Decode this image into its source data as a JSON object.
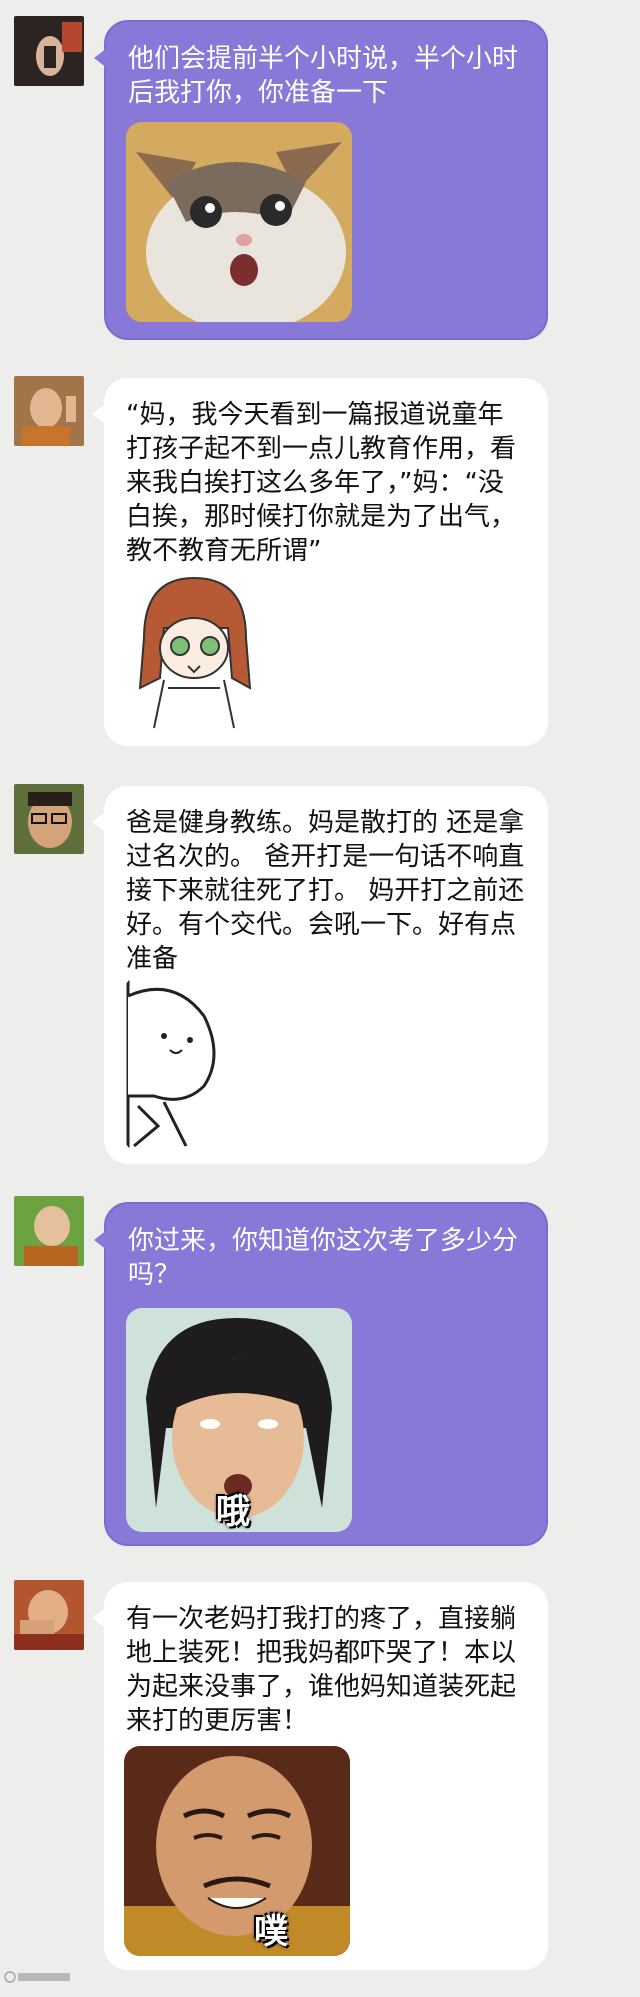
{
  "messages": [
    {
      "text": "他们会提前半个小时说，半个小时后我打你，你准备一下",
      "sticker": "shocked-cat-icon"
    },
    {
      "text": "“妈，我今天看到一篇报道说童年打孩子起不到一点儿教育作用，看来我白挨打这么多年了，”妈：“没白挨，那时候打你就是为了出气，教不教育无所谓”",
      "sticker": "cartoon-girl-icon"
    },
    {
      "text": "爸是健身教练。妈是散打的 还是拿过名次的。 爸开打是一句话不响直接下来就往死了打。 妈开打之前还好。有个交代。会吼一下。好有点准备",
      "sticker": "peeking-blob-icon"
    },
    {
      "text": "你过来，你知道你这次考了多少分吗？",
      "sticker": "surprised-man-icon",
      "caption": "哦"
    },
    {
      "text": "有一次老妈打我打的疼了，直接躺地上装死！把我妈都吓哭了！本以为起来没事了，谁他妈知道装死起来打的更厉害！",
      "sticker": "laughing-man-icon",
      "caption": "噗"
    }
  ],
  "colors": {
    "purple_bubble": "#8879d8",
    "white_bubble": "#ffffff",
    "background": "#ededec"
  }
}
